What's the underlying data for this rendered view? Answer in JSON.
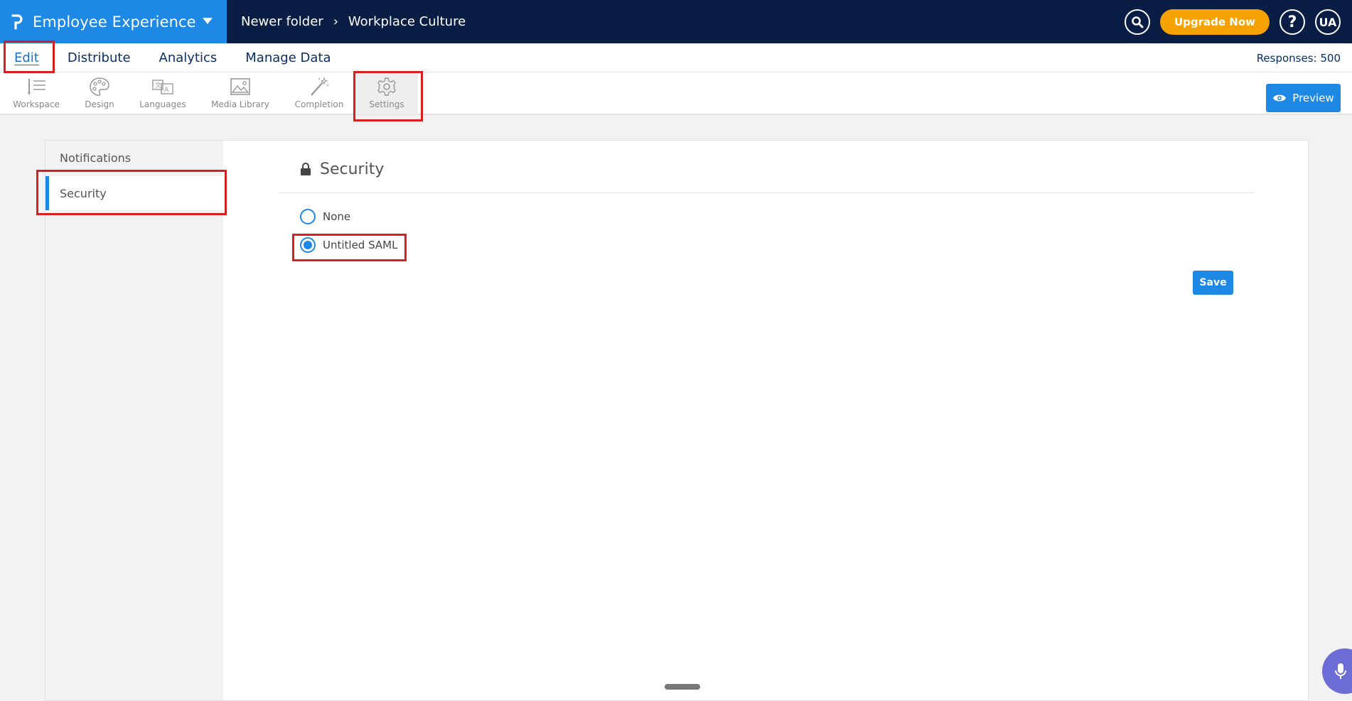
{
  "topbar": {
    "app_title": "Employee Experience",
    "breadcrumb": [
      "Newer folder",
      "Workplace Culture"
    ],
    "upgrade_label": "Upgrade Now",
    "avatar_initials": "UA",
    "help_label": "?"
  },
  "nav": {
    "tabs": [
      "Edit",
      "Distribute",
      "Analytics",
      "Manage Data"
    ],
    "active": "Edit",
    "responses": "Responses: 500"
  },
  "toolbar": {
    "tools": [
      "Workspace",
      "Design",
      "Languages",
      "Media Library",
      "Completion",
      "Settings"
    ],
    "active": "Settings",
    "preview_label": "Preview"
  },
  "sidebar": {
    "items": [
      "Notifications",
      "Security"
    ],
    "active": "Security"
  },
  "security": {
    "title": "Security",
    "options": [
      "None",
      "Untitled SAML"
    ],
    "selected": "Untitled SAML",
    "save_label": "Save"
  },
  "colors": {
    "topbar_bg": "#0a1e45",
    "brand_bg": "#1e88e5",
    "accent": "#1e88e5",
    "upgrade": "#f5a100",
    "highlight": "#d92020"
  }
}
